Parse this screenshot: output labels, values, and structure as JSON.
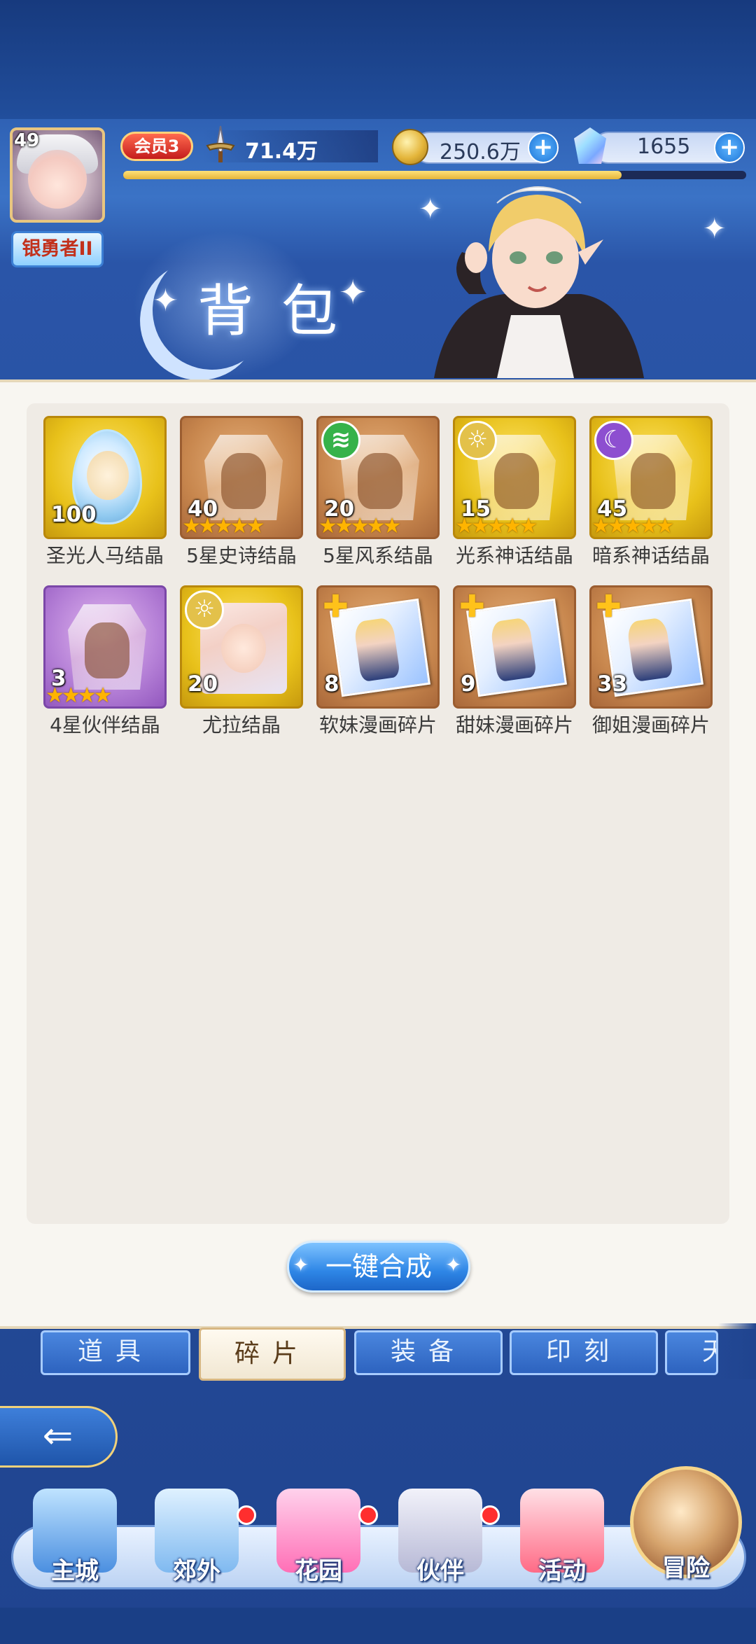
{
  "player": {
    "level": "49",
    "rank_title": "银勇者II",
    "vip": "会员3",
    "power": "71.4万",
    "exp_fraction": 0.8
  },
  "resources": {
    "gold": "250.6万",
    "diamonds": "1655",
    "add_icon": "plus-icon"
  },
  "header": {
    "title": "背包"
  },
  "items": [
    {
      "name": "圣光人马结晶",
      "count": "100",
      "frame": "gold",
      "art": "egg",
      "stars": 0,
      "badge": ""
    },
    {
      "name": "5星史诗结晶",
      "count": "40",
      "frame": "orange",
      "art": "crystal",
      "stars": 5,
      "badge": ""
    },
    {
      "name": "5星风系结晶",
      "count": "20",
      "frame": "orange",
      "art": "crystal",
      "stars": 5,
      "badge": "wind-element-icon"
    },
    {
      "name": "光系神话结晶",
      "count": "15",
      "frame": "gold",
      "art": "crystal",
      "stars": 5,
      "badge": "light-element-icon"
    },
    {
      "name": "暗系神话结晶",
      "count": "45",
      "frame": "gold",
      "art": "crystal",
      "stars": 5,
      "badge": "dark-element-icon"
    },
    {
      "name": "4星伙伴结晶",
      "count": "3",
      "frame": "purple",
      "art": "crystal",
      "stars": 4,
      "badge": ""
    },
    {
      "name": "尤拉结晶",
      "count": "20",
      "frame": "gold",
      "art": "portrait",
      "stars": 0,
      "badge": "light-element-icon"
    },
    {
      "name": "软妹漫画碎片",
      "count": "8",
      "frame": "orange",
      "art": "manga",
      "stars": 0,
      "badge": "puzzle-icon"
    },
    {
      "name": "甜妹漫画碎片",
      "count": "9",
      "frame": "orange",
      "art": "manga",
      "stars": 0,
      "badge": "puzzle-icon"
    },
    {
      "name": "御姐漫画碎片",
      "count": "33",
      "frame": "orange",
      "art": "manga",
      "stars": 0,
      "badge": "puzzle-icon"
    }
  ],
  "merge_button": "一键合成",
  "tabs": [
    {
      "label": "道具",
      "active": false
    },
    {
      "label": "碎片",
      "active": true
    },
    {
      "label": "装备",
      "active": false
    },
    {
      "label": "印刻",
      "active": false
    },
    {
      "label": "天",
      "active": false
    }
  ],
  "back_icon": "back-arrow-icon",
  "nav": [
    {
      "label": "主城",
      "icon": "castle-icon",
      "badge": false
    },
    {
      "label": "郊外",
      "icon": "portal-icon",
      "badge": true
    },
    {
      "label": "花园",
      "icon": "heart-garden-icon",
      "badge": true
    },
    {
      "label": "伙伴",
      "icon": "partner-icon",
      "badge": true
    },
    {
      "label": "活动",
      "icon": "gift-icon",
      "badge": false
    },
    {
      "label": "冒险",
      "icon": "compass-icon",
      "badge": false
    }
  ],
  "colors": {
    "accent_blue": "#2e86e6",
    "gold": "#e8c11a",
    "badge_red": "#ff2e2e"
  }
}
